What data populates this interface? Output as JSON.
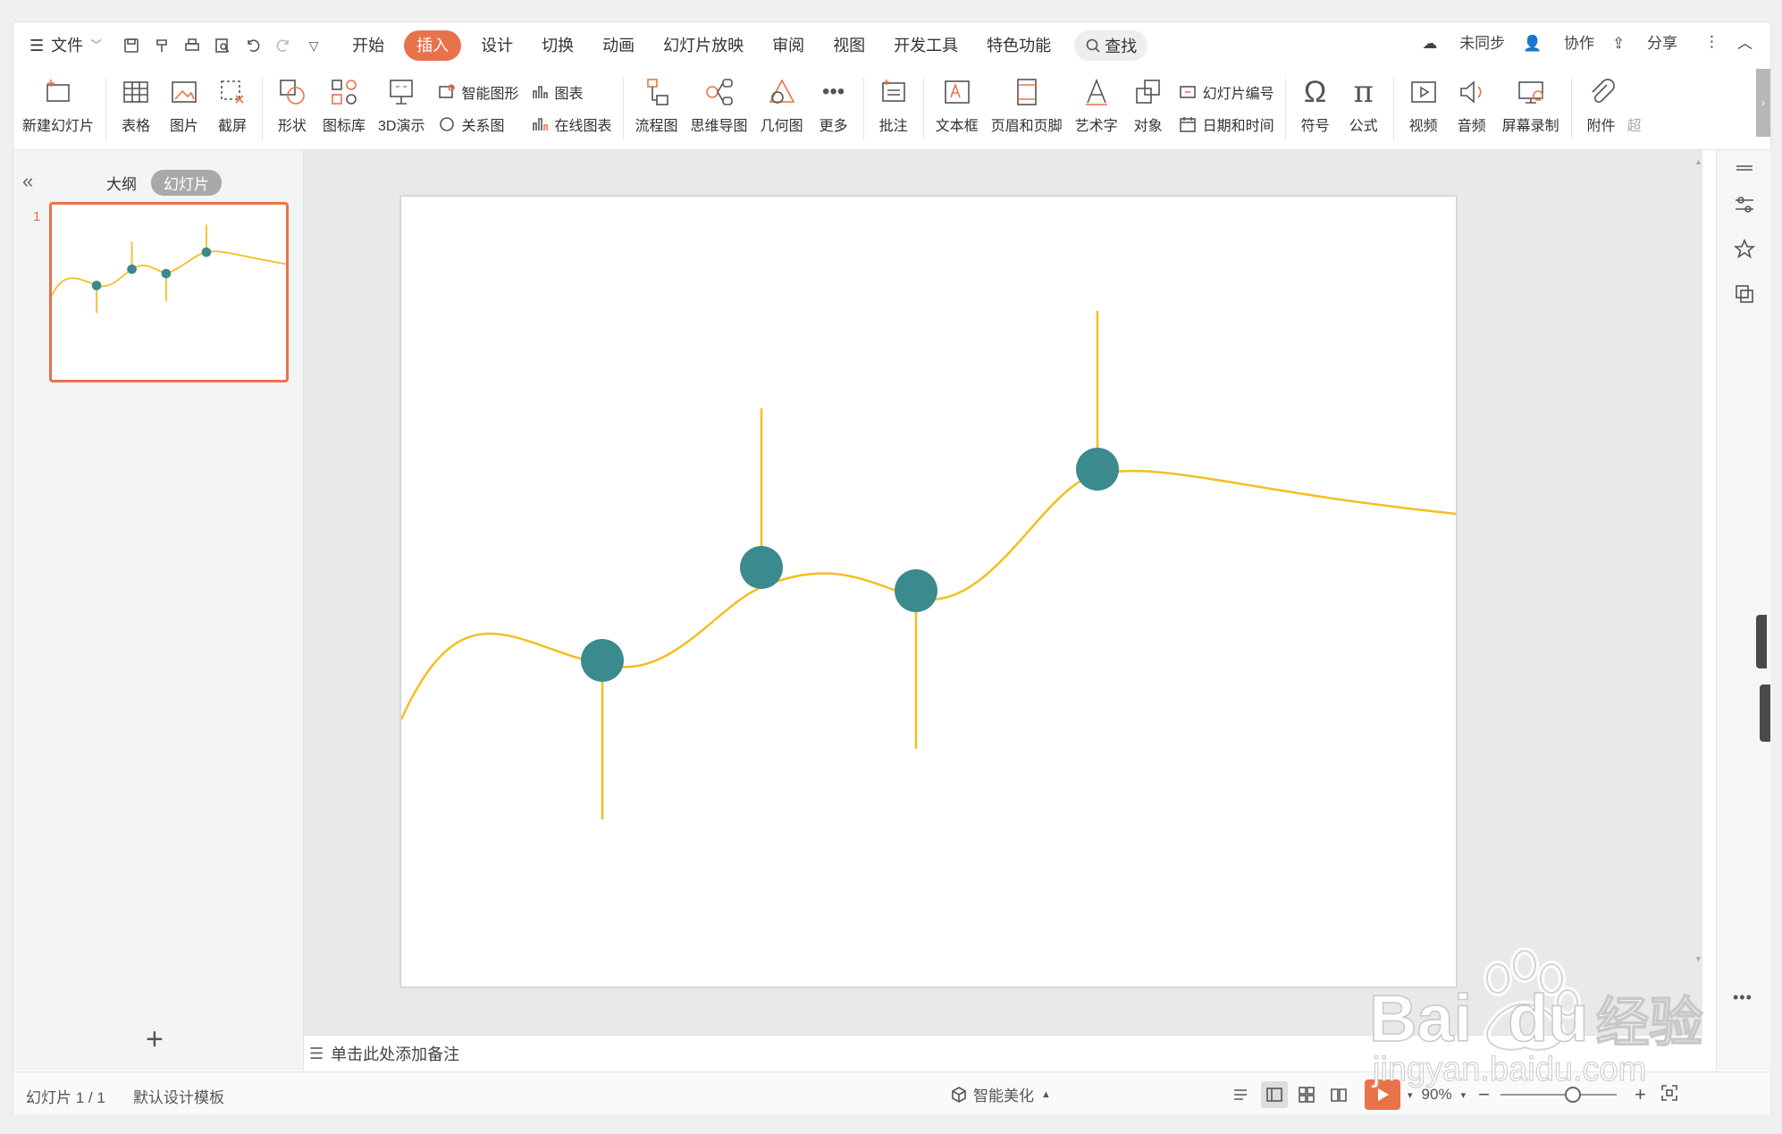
{
  "menubar": {
    "file": "文件",
    "tabs": [
      {
        "label": "开始"
      },
      {
        "label": "插入"
      },
      {
        "label": "设计"
      },
      {
        "label": "切换"
      },
      {
        "label": "动画"
      },
      {
        "label": "幻灯片放映"
      },
      {
        "label": "审阅"
      },
      {
        "label": "视图"
      },
      {
        "label": "开发工具"
      },
      {
        "label": "特色功能"
      }
    ],
    "search_label": "查找",
    "sync": "未同步",
    "collab": "协作",
    "share": "分享"
  },
  "ribbon": {
    "new_slide": "新建幻灯片",
    "table": "表格",
    "picture": "图片",
    "screenshot": "截屏",
    "shape": "形状",
    "icon_lib": "图标库",
    "demo3d": "3D演示",
    "smart_shape": "智能图形",
    "chart": "图表",
    "relation": "关系图",
    "online_chart": "在线图表",
    "flowchart": "流程图",
    "mindmap": "思维导图",
    "geometry": "几何图",
    "more": "更多",
    "comment": "批注",
    "textbox": "文本框",
    "header_footer": "页眉和页脚",
    "wordart": "艺术字",
    "object": "对象",
    "slide_number": "幻灯片编号",
    "datetime": "日期和时间",
    "symbol": "符号",
    "formula": "公式",
    "video": "视频",
    "audio": "音频",
    "screen_record": "屏幕录制",
    "attachment": "附件",
    "overflow": "超"
  },
  "leftpane": {
    "tab_outline": "大纲",
    "tab_slides": "幻灯片",
    "slide_number": "1"
  },
  "notes_placeholder": "单击此处添加备注",
  "status": {
    "slide_pos": "幻灯片 1 / 1",
    "template": "默认设计模板",
    "beautify": "智能美化",
    "zoom": "90%"
  },
  "colors": {
    "accent": "#e8734a",
    "curve": "#f5be1e",
    "dot": "#3a8a8e"
  },
  "watermark": {
    "brand": "Bai",
    "brand2": "du",
    "cn": "经验",
    "url": "jingyan.baidu.com"
  }
}
